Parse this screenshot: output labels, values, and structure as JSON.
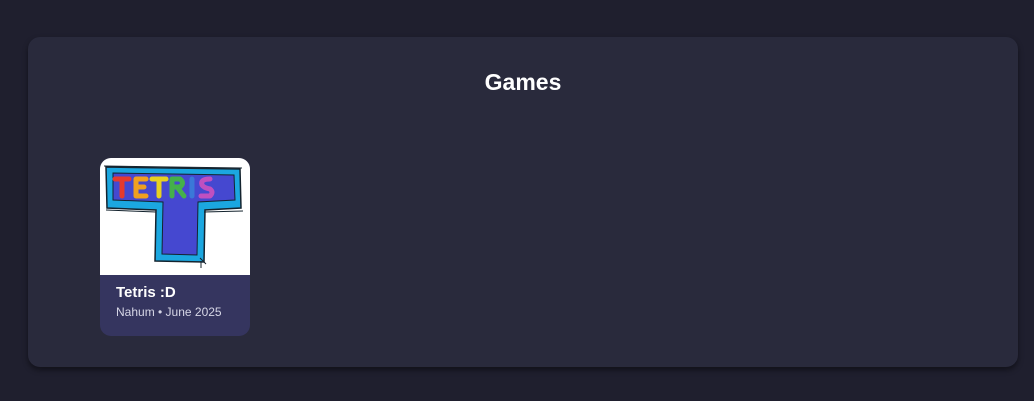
{
  "page": {
    "background": "#1f1f2e",
    "panel_background": "#292a3c"
  },
  "section": {
    "title": "Games"
  },
  "games": [
    {
      "title": "Tetris :D",
      "author": "Nahum",
      "separator": "•",
      "date": "June 2025",
      "meta": "Nahum • June 2025",
      "thumbnail": {
        "icon": "tetris-drawing-icon",
        "lettering": "TETRIS",
        "colors": {
          "outline": "#1ba7e0",
          "fill": "#4548d0",
          "T1": "#e63a2d",
          "E": "#f0a020",
          "T2": "#e8d020",
          "R": "#45b04a",
          "I": "#3a78d8",
          "S": "#c050c0"
        }
      },
      "card_background": "#35355f"
    }
  ]
}
